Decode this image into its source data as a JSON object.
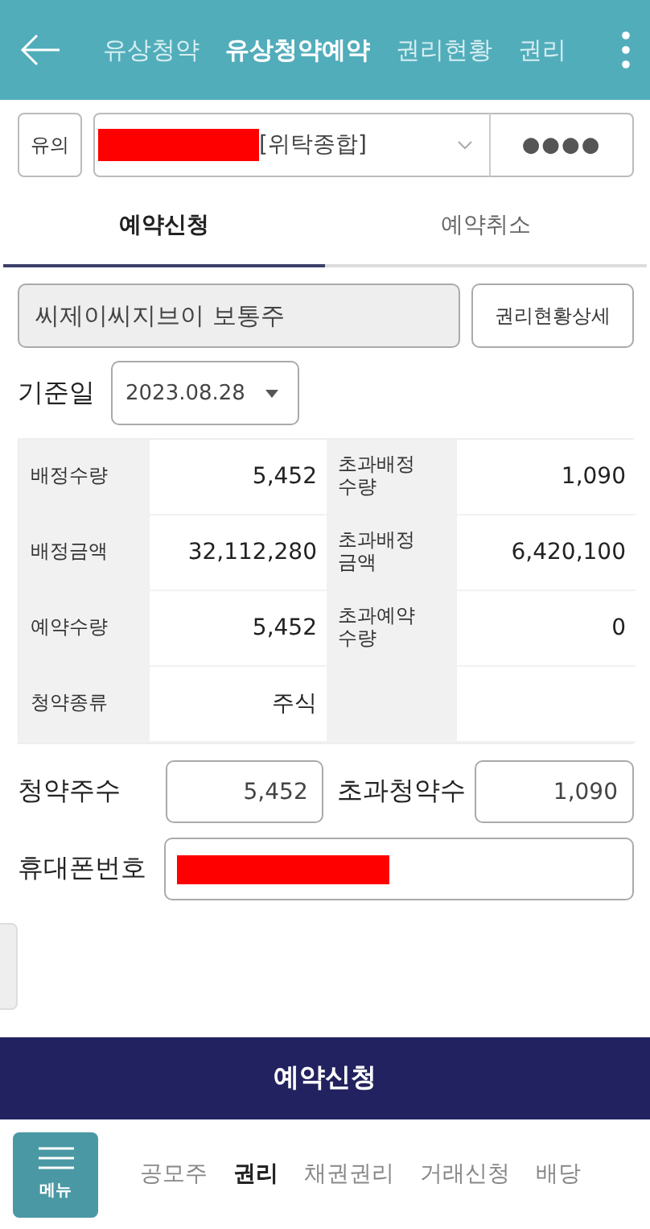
{
  "header": {
    "tabs": [
      {
        "label": "유상청약",
        "selected": false
      },
      {
        "label": "유상청약예약",
        "selected": true
      },
      {
        "label": "권리현황",
        "selected": false
      },
      {
        "label": "권리",
        "selected": false
      }
    ]
  },
  "account": {
    "notice_button": "유의",
    "account_select": {
      "redacted": true,
      "value": "[위탁종합]"
    },
    "password": "●●●●"
  },
  "tabs": [
    {
      "label": "예약신청",
      "selected": true
    },
    {
      "label": "예약취소",
      "selected": false
    }
  ],
  "stock": {
    "name": "씨제이씨지브이 보통주",
    "detail_button": "권리현황상세"
  },
  "base_date": {
    "label": "기준일",
    "value": "2023.08.28"
  },
  "table": {
    "rows": [
      [
        {
          "kind": "label",
          "text": "배정수량"
        },
        {
          "kind": "value",
          "text": "5,452"
        },
        {
          "kind": "label",
          "text": "초과배정\n수량"
        },
        {
          "kind": "value",
          "text": "1,090"
        }
      ],
      [
        {
          "kind": "label",
          "text": "배정금액"
        },
        {
          "kind": "value",
          "text": "32,112,280"
        },
        {
          "kind": "label",
          "text": "초과배정\n금액"
        },
        {
          "kind": "value",
          "text": "6,420,100"
        }
      ],
      [
        {
          "kind": "label",
          "text": "예약수량"
        },
        {
          "kind": "value",
          "text": "5,452"
        },
        {
          "kind": "label",
          "text": "초과예약\n수량"
        },
        {
          "kind": "value",
          "text": "0"
        }
      ],
      [
        {
          "kind": "label",
          "text": "청약종류"
        },
        {
          "kind": "value",
          "text": "주식"
        }
      ]
    ]
  },
  "inputs": [
    {
      "label": "청약주수",
      "value": "5,452"
    },
    {
      "label": "초과청약수",
      "value": "1,090"
    }
  ],
  "phone": {
    "label": "휴대폰번호",
    "redacted": true
  },
  "submit_button": "예약신청",
  "bottom_nav": {
    "menu_button": "메뉴",
    "items": [
      {
        "label": "공모주",
        "selected": false
      },
      {
        "label": "권리",
        "selected": true
      },
      {
        "label": "채권권리",
        "selected": false
      },
      {
        "label": "거래신청",
        "selected": false
      },
      {
        "label": "배당",
        "selected": false
      }
    ]
  }
}
